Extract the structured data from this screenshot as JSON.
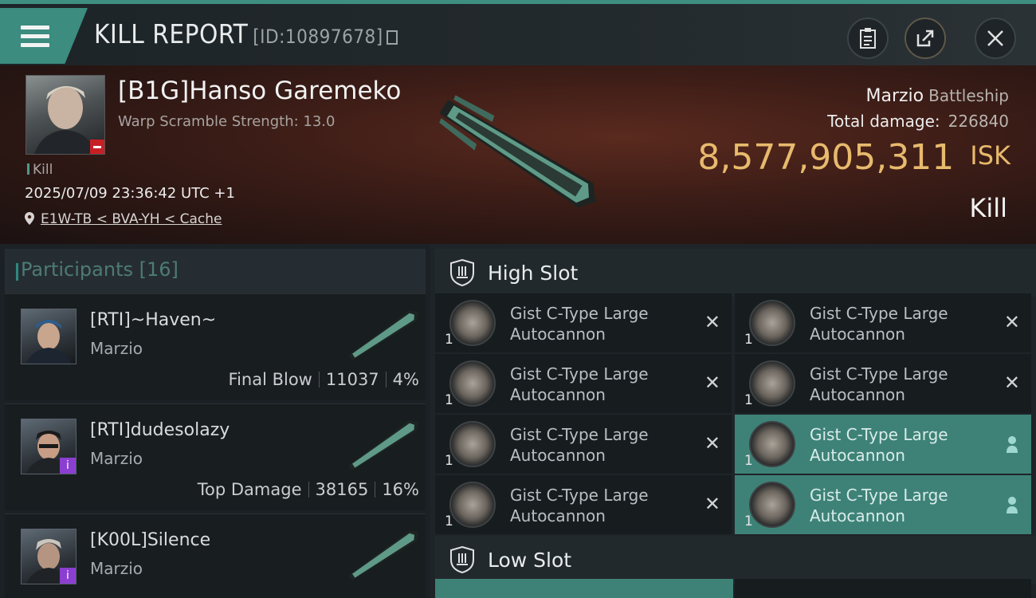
{
  "header": {
    "title": "KILL REPORT",
    "report_id": "[ID:10897678]"
  },
  "victim": {
    "name": "[B1G]Hanso Garemeko",
    "scram": "Warp Scramble Strength: 13.0",
    "tag": "Kill",
    "datetime": "2025/07/09 23:36:42 UTC +1",
    "location": "E1W-TB < BVA-YH < Cache",
    "ship": "Marzio",
    "ship_class": "Battleship",
    "total_damage_label": "Total damage:",
    "total_damage": "226840",
    "isk_value": "8,577,905,311",
    "isk_unit": "ISK",
    "result": "Kill"
  },
  "participants": {
    "label": "Participants",
    "count": "[16]",
    "list": [
      {
        "name": "[RTI]~Haven~",
        "ship": "Marzio",
        "role": "Final Blow",
        "damage": "11037",
        "percent": "4%"
      },
      {
        "name": "[RTI]dudesolazy",
        "ship": "Marzio",
        "role": "Top Damage",
        "damage": "38165",
        "percent": "16%"
      },
      {
        "name": "[K00L]Silence",
        "ship": "Marzio"
      }
    ]
  },
  "slots": {
    "high_label": "High Slot",
    "low_label": "Low Slot",
    "module_line1": "Gist C-Type Large",
    "module_line2": "Autocannon",
    "qty": "1",
    "accent": "#3e8277"
  }
}
